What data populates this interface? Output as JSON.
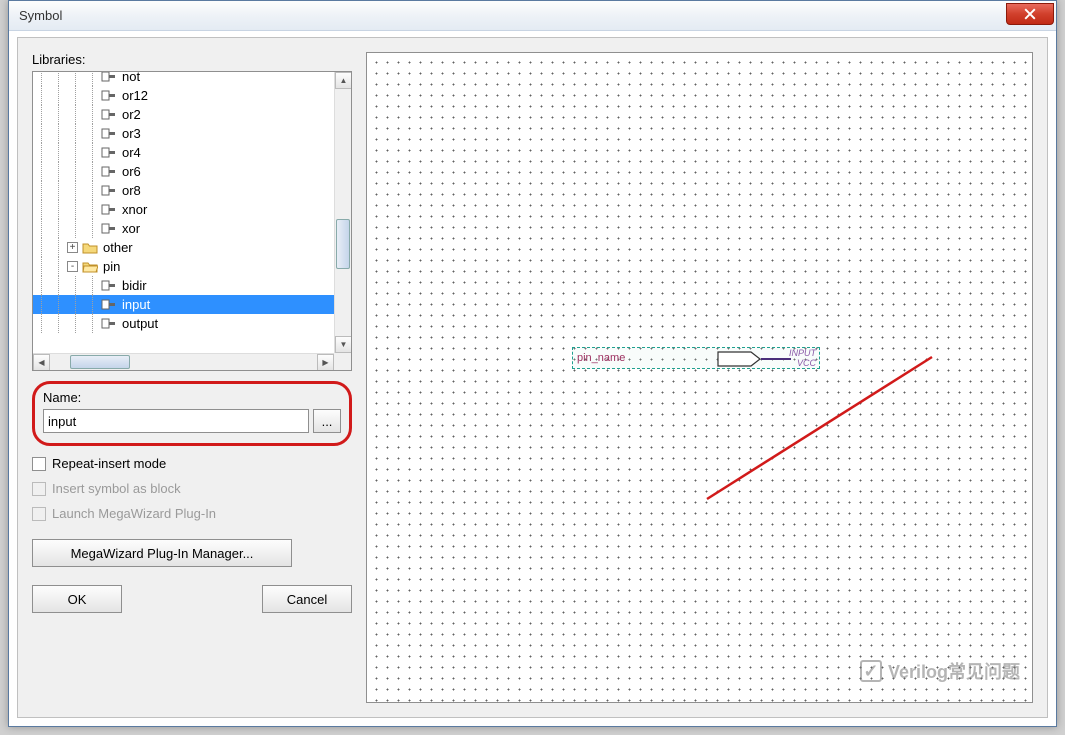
{
  "window": {
    "title": "Symbol"
  },
  "labels": {
    "libraries": "Libraries:",
    "name": "Name:"
  },
  "tree": {
    "items": [
      {
        "indent": 4,
        "kind": "leaf",
        "label": "not"
      },
      {
        "indent": 4,
        "kind": "leaf",
        "label": "or12"
      },
      {
        "indent": 4,
        "kind": "leaf",
        "label": "or2"
      },
      {
        "indent": 4,
        "kind": "leaf",
        "label": "or3"
      },
      {
        "indent": 4,
        "kind": "leaf",
        "label": "or4"
      },
      {
        "indent": 4,
        "kind": "leaf",
        "label": "or6"
      },
      {
        "indent": 4,
        "kind": "leaf",
        "label": "or8"
      },
      {
        "indent": 4,
        "kind": "leaf",
        "label": "xnor"
      },
      {
        "indent": 4,
        "kind": "leaf",
        "label": "xor"
      },
      {
        "indent": 2,
        "kind": "folder-closed",
        "expander": "+",
        "label": "other"
      },
      {
        "indent": 2,
        "kind": "folder-open",
        "expander": "-",
        "label": "pin"
      },
      {
        "indent": 4,
        "kind": "leaf",
        "label": "bidir"
      },
      {
        "indent": 4,
        "kind": "leaf",
        "label": "input",
        "selected": true
      },
      {
        "indent": 4,
        "kind": "leaf",
        "label": "output"
      }
    ]
  },
  "name_field": {
    "value": "input",
    "browse": "..."
  },
  "checkboxes": [
    {
      "label": "Repeat-insert mode",
      "enabled": true
    },
    {
      "label": "Insert symbol as block",
      "enabled": false
    },
    {
      "label": "Launch MegaWizard Plug-In",
      "enabled": false
    }
  ],
  "buttons": {
    "mega": "MegaWizard Plug-In Manager...",
    "ok": "OK",
    "cancel": "Cancel"
  },
  "preview": {
    "pin_name": "pin_name",
    "type": "INPUT",
    "default": "VCC"
  },
  "watermark": "Verilog常见问题"
}
